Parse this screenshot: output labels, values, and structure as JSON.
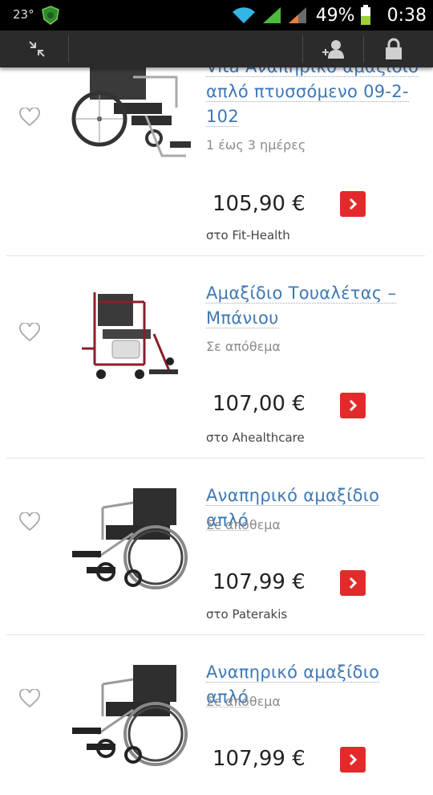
{
  "status_bar": {
    "temperature": "23°",
    "battery_percent": "49%",
    "time": "0:38"
  },
  "action_bar": {
    "icons": [
      "collapse-icon",
      "add-user-icon",
      "lock-icon"
    ]
  },
  "products": [
    {
      "title_line1": "Vita Αναπηρικό αμαξίδιο",
      "title_line2": "απλό πτυσσόμενο 09-2-",
      "title_line3": "102",
      "availability": "1 έως 3 ημέρες",
      "price": "105,90 €",
      "store": "στο Fit-Health"
    },
    {
      "title_line1": "Αμαξίδιο Τουαλέτας –",
      "title_line2": "Μπάνιου",
      "availability": "Σε απόθεμα",
      "price": "107,00 €",
      "store": "στο Ahealthcare"
    },
    {
      "title_line1": "Αναπηρικό αμαξίδιο απλό",
      "availability": "Σε απόθεμα",
      "price": "107,99 €",
      "store": "στο Paterakis"
    },
    {
      "title_line1": "Αναπηρικό αμαξίδιο απλό",
      "availability": "Σε απόθεμα",
      "price": "107,99 €",
      "store": ""
    }
  ],
  "colors": {
    "link": "#3d78b5",
    "go_button": "#e32a2a",
    "action_bar": "#2b2b2b"
  }
}
